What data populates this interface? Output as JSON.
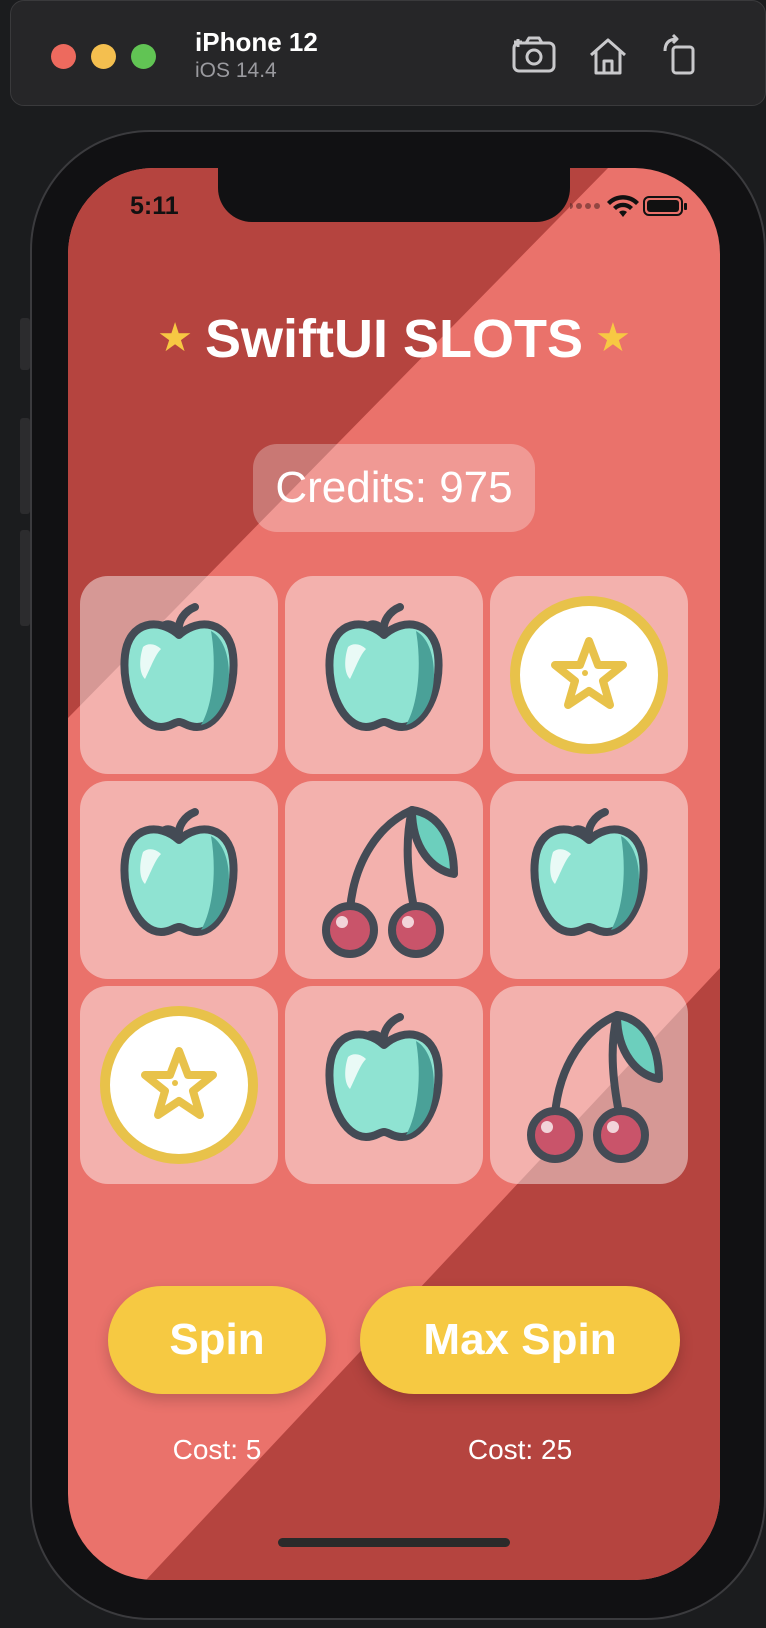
{
  "simulator": {
    "device_name": "iPhone 12",
    "os_version": "iOS 14.4",
    "toolbar_icons": [
      "screenshot-icon",
      "home-icon",
      "rotate-icon"
    ]
  },
  "status_bar": {
    "time": "5:11"
  },
  "app": {
    "title": "SwiftUI SLOTS",
    "title_star": "★",
    "credits_label": "Credits: 975",
    "slots": [
      [
        "apple",
        "apple",
        "star-coin"
      ],
      [
        "apple",
        "cherry",
        "apple"
      ],
      [
        "star-coin",
        "apple",
        "cherry"
      ]
    ],
    "spin_button": "Spin",
    "max_spin_button": "Max Spin",
    "spin_cost": "Cost: 5",
    "max_spin_cost": "Cost: 25"
  },
  "colors": {
    "background_dark": "#b5443f",
    "background_light": "#ea726b",
    "button": "#f6c942",
    "star": "#f7c843"
  }
}
